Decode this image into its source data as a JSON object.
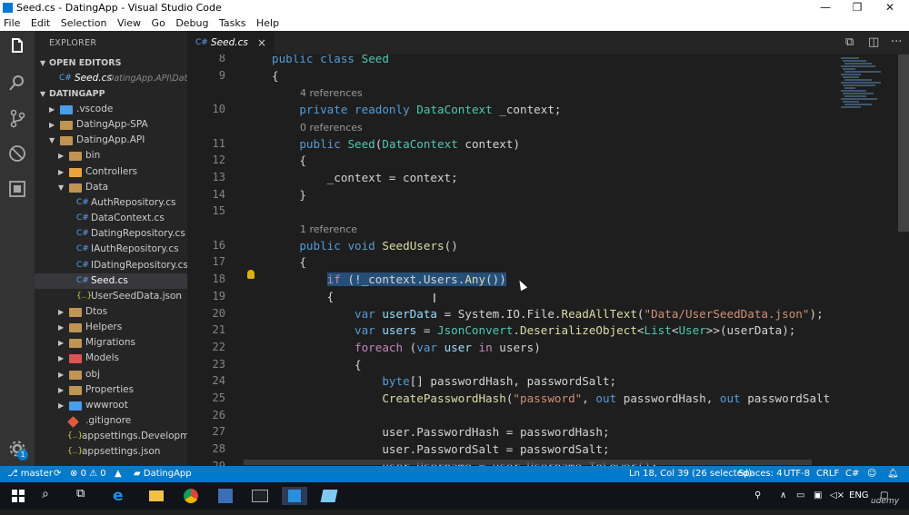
{
  "window": {
    "title": "Seed.cs - DatingApp - Visual Studio Code"
  },
  "menu": [
    "File",
    "Edit",
    "Selection",
    "View",
    "Go",
    "Debug",
    "Tasks",
    "Help"
  ],
  "explorer": {
    "header": "EXPLORER",
    "open_editors": {
      "label": "OPEN EDITORS",
      "files": [
        {
          "name": "Seed.cs",
          "path": "DatingApp.API\\Data"
        }
      ]
    },
    "workspace": "DATINGAPP",
    "tree": [
      {
        "label": ".vscode",
        "level": 1,
        "kind": "folder-blue",
        "twisty": "▶"
      },
      {
        "label": "DatingApp-SPA",
        "level": 1,
        "kind": "folder",
        "twisty": "▶"
      },
      {
        "label": "DatingApp.API",
        "level": 1,
        "kind": "folder",
        "twisty": "▼"
      },
      {
        "label": "bin",
        "level": 2,
        "kind": "folder",
        "twisty": "▶"
      },
      {
        "label": "Controllers",
        "level": 2,
        "kind": "folder-orange",
        "twisty": "▶"
      },
      {
        "label": "Data",
        "level": 2,
        "kind": "folder",
        "twisty": "▼"
      },
      {
        "label": "AuthRepository.cs",
        "level": 3,
        "kind": "cs"
      },
      {
        "label": "DataContext.cs",
        "level": 3,
        "kind": "cs"
      },
      {
        "label": "DatingRepository.cs",
        "level": 3,
        "kind": "cs"
      },
      {
        "label": "IAuthRepository.cs",
        "level": 3,
        "kind": "cs"
      },
      {
        "label": "IDatingRepository.cs",
        "level": 3,
        "kind": "cs"
      },
      {
        "label": "Seed.cs",
        "level": 3,
        "kind": "cs",
        "selected": true
      },
      {
        "label": "UserSeedData.json",
        "level": 3,
        "kind": "json"
      },
      {
        "label": "Dtos",
        "level": 2,
        "kind": "folder",
        "twisty": "▶"
      },
      {
        "label": "Helpers",
        "level": 2,
        "kind": "folder",
        "twisty": "▶"
      },
      {
        "label": "Migrations",
        "level": 2,
        "kind": "folder",
        "twisty": "▶"
      },
      {
        "label": "Models",
        "level": 2,
        "kind": "folder-red",
        "twisty": "▶"
      },
      {
        "label": "obj",
        "level": 2,
        "kind": "folder",
        "twisty": "▶"
      },
      {
        "label": "Properties",
        "level": 2,
        "kind": "folder",
        "twisty": "▶"
      },
      {
        "label": "wwwroot",
        "level": 2,
        "kind": "folder-blue",
        "twisty": "▶"
      },
      {
        "label": ".gitignore",
        "level": 2,
        "kind": "git"
      },
      {
        "label": "appsettings.Developme...",
        "level": 2,
        "kind": "json"
      },
      {
        "label": "appsettings.json",
        "level": 2,
        "kind": "json"
      }
    ]
  },
  "tabs": [
    {
      "label": "Seed.cs",
      "lang": "C#",
      "close": "×"
    }
  ],
  "editor": {
    "lines": [
      {
        "n": "8",
        "html": "<span class=\"kw\">public</span> <span class=\"kw\">class</span> <span class=\"ty\">Seed</span>"
      },
      {
        "n": "9",
        "html": "{"
      },
      {
        "lens": "4 references"
      },
      {
        "n": "10",
        "html": "    <span class=\"kw\">private</span> <span class=\"kw\">readonly</span> <span class=\"ty\">DataContext</span> _context;"
      },
      {
        "lens": "0 references"
      },
      {
        "n": "11",
        "html": "    <span class=\"kw\">public</span> <span class=\"ty\">Seed</span>(<span class=\"ty\">DataContext</span> context)"
      },
      {
        "n": "12",
        "html": "    {"
      },
      {
        "n": "13",
        "html": "        _context = context;"
      },
      {
        "n": "14",
        "html": "    }"
      },
      {
        "n": "15",
        "html": ""
      },
      {
        "lens": "1 reference"
      },
      {
        "n": "16",
        "html": "    <span class=\"kw\">public</span> <span class=\"kw\">void</span> <span class=\"fn\">SeedUsers</span>()"
      },
      {
        "n": "17",
        "html": "    {"
      },
      {
        "n": "18",
        "html": "        <span class=\"hl\"><span class=\"ctl\">if</span> (!_context.Users.<span class=\"fn\">Any</span>())</span>"
      },
      {
        "n": "19",
        "html": "        {"
      },
      {
        "n": "20",
        "html": "            <span class=\"kw\">var</span> <span class=\"vr\">userData</span> = System.IO.File.<span class=\"fn\">ReadAllText</span>(<span class=\"str\">\"Data/UserSeedData.json\"</span>);"
      },
      {
        "n": "21",
        "html": "            <span class=\"kw\">var</span> <span class=\"vr\">users</span> = <span class=\"ty\">JsonConvert</span>.<span class=\"fn\">DeserializeObject</span>&lt;<span class=\"ty\">List</span>&lt;<span class=\"ty\">User</span>&gt;&gt;(userData);"
      },
      {
        "n": "22",
        "html": "            <span class=\"ctl\">foreach</span> (<span class=\"kw\">var</span> <span class=\"vr\">user</span> <span class=\"ctl\">in</span> users)"
      },
      {
        "n": "23",
        "html": "            {"
      },
      {
        "n": "24",
        "html": "                <span class=\"kw\">byte</span>[] passwordHash, passwordSalt;"
      },
      {
        "n": "25",
        "html": "                <span class=\"fn\">CreatePasswordHash</span>(<span class=\"str\">\"password\"</span>, <span class=\"kw\">out</span> passwordHash, <span class=\"kw\">out</span> passwordSalt"
      },
      {
        "n": "26",
        "html": ""
      },
      {
        "n": "27",
        "html": "                user.PasswordHash = passwordHash;"
      },
      {
        "n": "28",
        "html": "                user.PasswordSalt = passwordSalt;"
      },
      {
        "n": "29",
        "html": "                user.Username = user.Username.<span class=\"fn\">ToLower</span>();"
      }
    ]
  },
  "statusbar": {
    "branch": "master",
    "sync_icon": "sync-icon",
    "errors": "0",
    "warnings": "0",
    "project": "DatingApp",
    "position": "Ln 18, Col 39 (26 selected)",
    "spaces": "Spaces: 4",
    "encoding": "UTF-8",
    "eol": "CRLF",
    "language": "C#"
  },
  "activity_badge": "1",
  "taskbar": {
    "lang": "ENG",
    "watermark": "udemy"
  },
  "colors": {
    "accent": "#007acc",
    "selection": "#264f78"
  }
}
